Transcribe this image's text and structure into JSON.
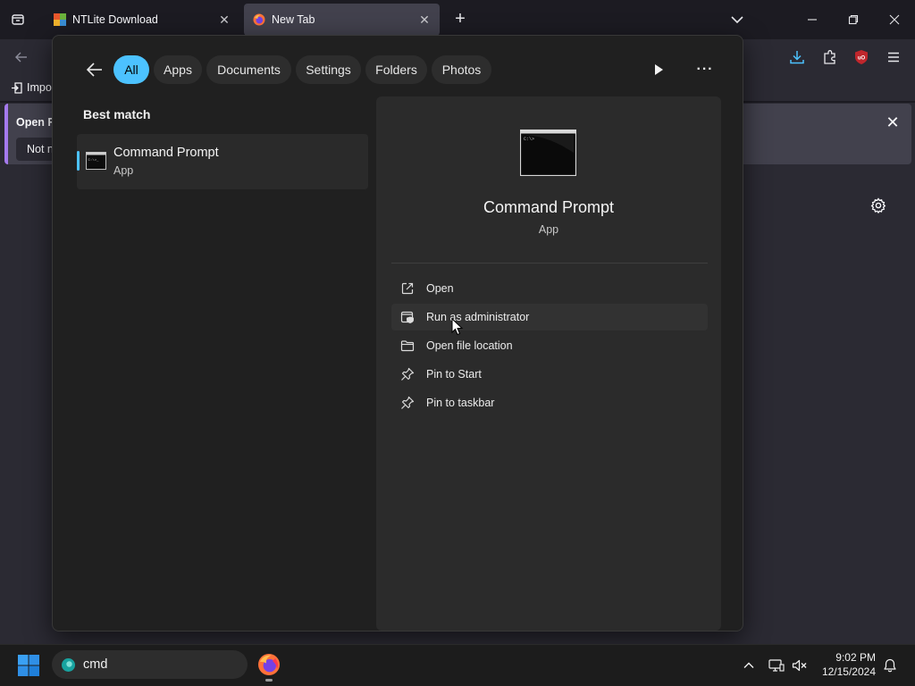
{
  "browser": {
    "tabs": [
      {
        "title": "NTLite Download",
        "active": false
      },
      {
        "title": "New Tab",
        "active": true
      }
    ],
    "bookmarks": {
      "import_label": "Impo"
    },
    "notification": {
      "title": "Open F",
      "button_label": "Not n"
    }
  },
  "search_panel": {
    "filters": [
      "All",
      "Apps",
      "Documents",
      "Settings",
      "Folders",
      "Photos"
    ],
    "active_filter": "All",
    "best_match_heading": "Best match",
    "best_match": {
      "title": "Command Prompt",
      "subtitle": "App"
    },
    "preview": {
      "title": "Command Prompt",
      "subtitle": "App",
      "actions": [
        {
          "label": "Open",
          "icon": "open-external-icon"
        },
        {
          "label": "Run as administrator",
          "icon": "shield-window-icon"
        },
        {
          "label": "Open file location",
          "icon": "folder-icon"
        },
        {
          "label": "Pin to Start",
          "icon": "pin-icon"
        },
        {
          "label": "Pin to taskbar",
          "icon": "pin-icon"
        }
      ]
    }
  },
  "taskbar": {
    "search_text": "cmd",
    "clock": {
      "time": "9:02 PM",
      "date": "12/15/2024"
    }
  },
  "colors": {
    "accent": "#4cc2ff",
    "panel_bg": "#202020",
    "preview_bg": "#2b2b2b",
    "browser_active_tab": "#42414d",
    "ublock_red": "#c0262c"
  }
}
